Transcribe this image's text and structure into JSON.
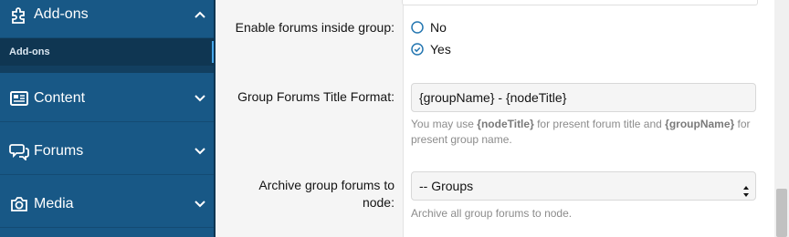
{
  "sidebar": {
    "sections": [
      {
        "label": "Add-ons",
        "icon": "puzzle-icon",
        "expanded": true
      },
      {
        "label": "Content",
        "icon": "newspaper-icon",
        "expanded": false
      },
      {
        "label": "Forums",
        "icon": "comments-icon",
        "expanded": false
      },
      {
        "label": "Media",
        "icon": "camera-icon",
        "expanded": false
      }
    ],
    "subitem": {
      "label": "Add-ons",
      "active": true
    }
  },
  "form": {
    "enable_forums": {
      "label": "Enable forums inside group:",
      "options": [
        {
          "label": "No",
          "selected": false
        },
        {
          "label": "Yes",
          "selected": true
        }
      ]
    },
    "title_format": {
      "label": "Group Forums Title Format:",
      "value": "{groupName} - {nodeTitle}",
      "hint_prefix": "You may use ",
      "hint_token1": "{nodeTitle}",
      "hint_mid": " for present forum title and ",
      "hint_token2": "{groupName}",
      "hint_suffix1": " for",
      "hint_line2": "present group name."
    },
    "archive_node": {
      "label_line1": "Archive group forums to",
      "label_line2": "node:",
      "selected": "-- Groups",
      "hint": "Archive all group forums to node."
    }
  },
  "colors": {
    "sidebar_bg": "#185886",
    "sidebar_sub_bg": "#0f3652",
    "accent": "#47a7eb",
    "radio_blue": "#2577b1"
  }
}
